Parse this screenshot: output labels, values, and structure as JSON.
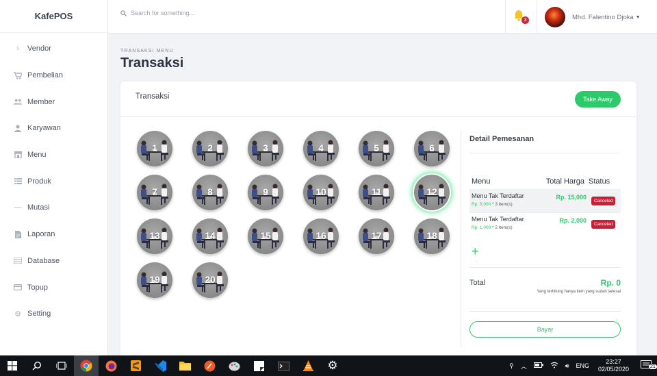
{
  "app": {
    "brand": "KafePOS"
  },
  "sidebar": {
    "items": [
      {
        "label": "Vendor",
        "icon": "chevron-right-icon"
      },
      {
        "label": "Pembelian",
        "icon": "cart-icon"
      },
      {
        "label": "Member",
        "icon": "users-icon"
      },
      {
        "label": "Karyawan",
        "icon": "user-icon"
      },
      {
        "label": "Menu",
        "icon": "store-icon"
      },
      {
        "label": "Produk",
        "icon": "list-icon"
      },
      {
        "label": "Mutasi",
        "icon": "minus-icon"
      },
      {
        "label": "Laporan",
        "icon": "file-icon"
      },
      {
        "label": "Database",
        "icon": "database-icon"
      },
      {
        "label": "Topup",
        "icon": "card-icon"
      },
      {
        "label": "Setting",
        "icon": "gear-icon"
      }
    ]
  },
  "topbar": {
    "search_placeholder": "Search for something...",
    "notification_count": "3",
    "user_name": "Mhd. Falentino Djoka"
  },
  "page": {
    "breadcrumb": "TRANSAKSI MENU",
    "title": "Transaksi"
  },
  "card": {
    "title": "Transaksi",
    "take_away_label": "Take Away"
  },
  "tables": {
    "active": "12",
    "numbers": [
      "1",
      "2",
      "3",
      "4",
      "5",
      "6",
      "7",
      "8",
      "9",
      "10",
      "11",
      "12",
      "13",
      "14",
      "15",
      "16",
      "17",
      "18",
      "19",
      "20"
    ]
  },
  "detail": {
    "title": "Detail Pemesanan",
    "columns": {
      "menu": "Menu",
      "price": "Total Harga",
      "status": "Status"
    },
    "orders": [
      {
        "name": "Menu Tak Terdaftar",
        "unit_price": "Rp. 5,000",
        "qty": "* 3 item(s)",
        "total": "Rp. 15,000",
        "status": "Canceled"
      },
      {
        "name": "Menu Tak Terdaftar",
        "unit_price": "Rp. 1,000",
        "qty": "* 2 item(s)",
        "total": "Rp. 2,000",
        "status": "Canceled"
      }
    ],
    "total_label": "Total",
    "total_value": "Rp. 0",
    "total_note": "Yang terhitung hanya item yang sudah selesai",
    "pay_label": "Bayar"
  },
  "taskbar": {
    "language": "ENG",
    "time": "23:27",
    "date": "02/05/2020",
    "notification_count": "21"
  },
  "colors": {
    "accent": "#2ec96a",
    "danger": "#c7213a"
  }
}
